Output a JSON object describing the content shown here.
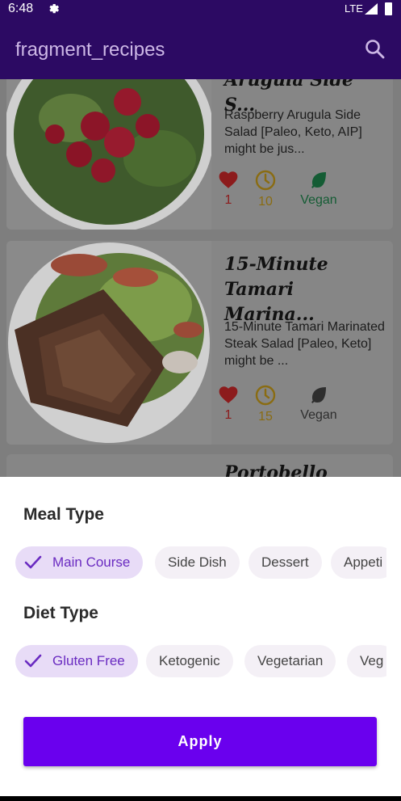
{
  "status_bar": {
    "time": "6:48",
    "network": "LTE",
    "icons": [
      "gear-icon",
      "signal-icon",
      "battery-icon"
    ]
  },
  "app_bar": {
    "title": "fragment_recipes",
    "search_icon": "search-icon"
  },
  "recipes": [
    {
      "title": "Arugula Side S...",
      "description": "Raspberry Arugula Side Salad [Paleo, Keto, AIP] might be jus...",
      "likes": "1",
      "minutes": "10",
      "diet_label": "Vegan",
      "vegan": true
    },
    {
      "title": "15-Minute Tamari Marina...",
      "description": "15-Minute Tamari Marinated Steak Salad [Paleo, Keto] might be ...",
      "likes": "1",
      "minutes": "15",
      "diet_label": "Vegan",
      "vegan": false
    },
    {
      "title": "Portobello Baked..."
    }
  ],
  "filter_sheet": {
    "meal_type": {
      "title": "Meal Type",
      "chips": [
        {
          "label": "Main Course",
          "selected": true
        },
        {
          "label": "Side Dish",
          "selected": false
        },
        {
          "label": "Dessert",
          "selected": false
        },
        {
          "label": "Appeti",
          "selected": false
        }
      ]
    },
    "diet_type": {
      "title": "Diet Type",
      "chips": [
        {
          "label": "Gluten Free",
          "selected": true
        },
        {
          "label": "Ketogenic",
          "selected": false
        },
        {
          "label": "Vegetarian",
          "selected": false
        },
        {
          "label": "Veg",
          "selected": false
        }
      ]
    },
    "apply_label": "Apply"
  },
  "colors": {
    "app_bar": "#2c0a63",
    "accent": "#6a00ee",
    "chip_selected_bg": "#e8dcf7",
    "chip_selected_text": "#6a2bc1",
    "vegan_active": "#0f8a4a",
    "heart": "#b4161b",
    "clock": "#b98b00"
  }
}
